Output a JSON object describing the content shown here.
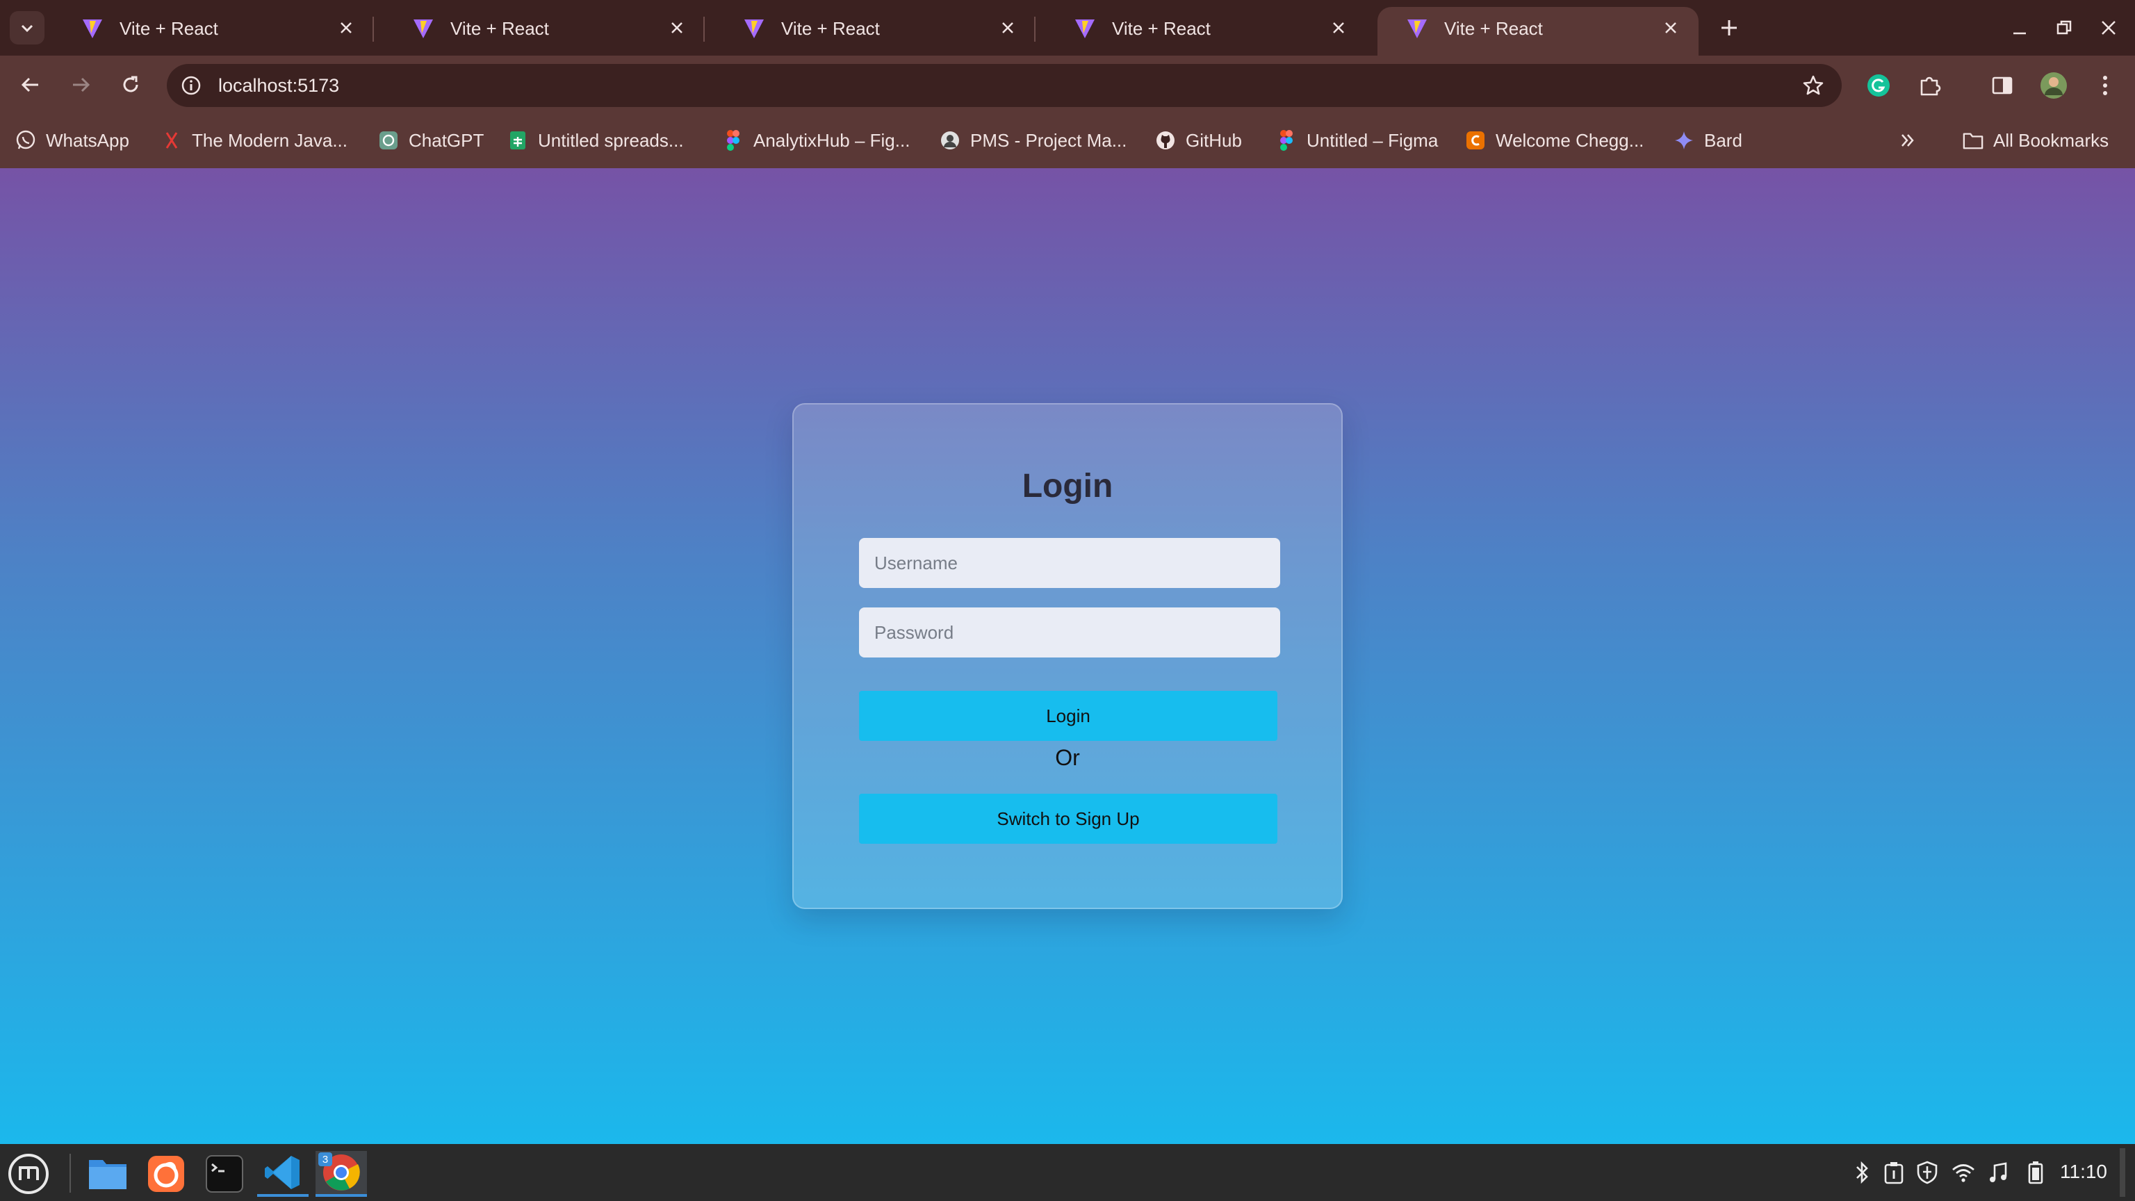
{
  "browser": {
    "tabs": [
      {
        "title": "Vite + React",
        "active": false
      },
      {
        "title": "Vite + React",
        "active": false
      },
      {
        "title": "Vite + React",
        "active": false
      },
      {
        "title": "Vite + React",
        "active": false
      },
      {
        "title": "Vite + React",
        "active": true
      }
    ],
    "url": "localhost:5173",
    "bookmarks": [
      {
        "label": "WhatsApp",
        "icon": "whatsapp-icon"
      },
      {
        "label": "The Modern Java...",
        "icon": "java-icon"
      },
      {
        "label": "ChatGPT",
        "icon": "chatgpt-icon"
      },
      {
        "label": "Untitled spreads...",
        "icon": "sheets-icon"
      },
      {
        "label": "AnalytixHub – Fig...",
        "icon": "figma-icon"
      },
      {
        "label": "PMS - Project Ma...",
        "icon": "avatar-icon"
      },
      {
        "label": "GitHub",
        "icon": "github-icon"
      },
      {
        "label": "Untitled – Figma",
        "icon": "figma-icon"
      },
      {
        "label": "Welcome Chegg...",
        "icon": "chegg-icon"
      },
      {
        "label": "Bard",
        "icon": "bard-icon"
      }
    ],
    "all_bookmarks_label": "All Bookmarks"
  },
  "login": {
    "title": "Login",
    "username_placeholder": "Username",
    "password_placeholder": "Password",
    "login_button": "Login",
    "or_text": "Or",
    "switch_button": "Switch to Sign Up"
  },
  "taskbar": {
    "chrome_badge": "3",
    "clock": "11:10"
  },
  "colors": {
    "gradient_top": "#7653a6",
    "gradient_bottom": "#1bb8ec",
    "button": "#17bdee",
    "browser_frame": "#3b2120"
  }
}
